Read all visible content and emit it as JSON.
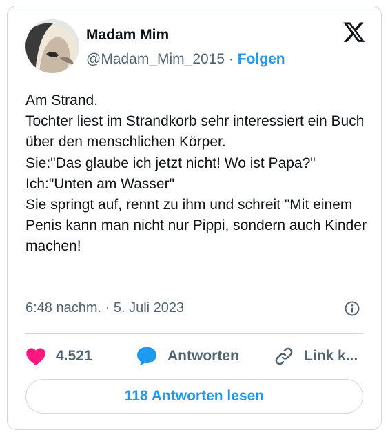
{
  "author": {
    "name": "Madam Mim",
    "handle": "@Madam_Mim_2015",
    "separator": "·",
    "follow_label": "Folgen"
  },
  "tweet": {
    "text": "Am Strand.\nTochter liest im Strandkorb sehr interessiert ein Buch über den menschlichen Körper.\nSie:\"Das glaube ich jetzt nicht! Wo ist Papa?\"\nIch:\"Unten am Wasser\"\nSie springt auf, rennt zu ihm und schreit \"Mit einem Penis kann man nicht nur Pippi, sondern auch Kinder machen!",
    "timestamp": "6:48 nachm. · 5. Juli 2023"
  },
  "actions": {
    "likes_count": "4.521",
    "reply_label": "Antworten",
    "copy_link_label": "Link k..."
  },
  "read_replies_label": "118 Antworten lesen",
  "icons": {
    "platform": "x-logo-icon",
    "info": "info-icon",
    "like": "heart-icon",
    "reply": "speech-bubble-icon",
    "link": "link-icon"
  },
  "colors": {
    "accent": "#1d9bf0",
    "like": "#f91880",
    "muted": "#536471",
    "text": "#0f1419",
    "border": "#cfd9de"
  }
}
